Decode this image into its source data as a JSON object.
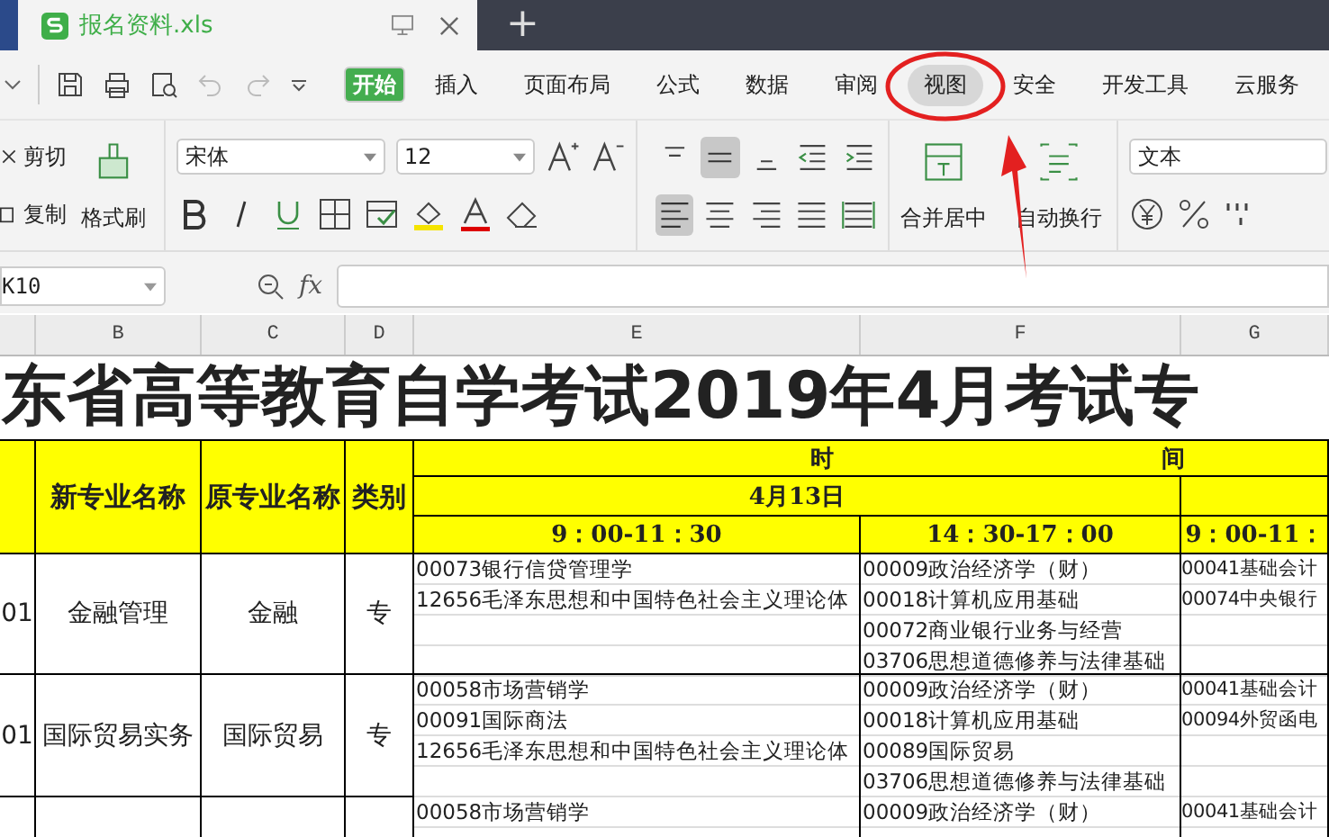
{
  "tab": {
    "title": "报名资料.xls",
    "new_tab": "+"
  },
  "menu": [
    {
      "label": "开始",
      "selected": true,
      "hovered": false
    },
    {
      "label": "插入",
      "selected": false,
      "hovered": false
    },
    {
      "label": "页面布局",
      "selected": false,
      "hovered": false
    },
    {
      "label": "公式",
      "selected": false,
      "hovered": false
    },
    {
      "label": "数据",
      "selected": false,
      "hovered": false
    },
    {
      "label": "审阅",
      "selected": false,
      "hovered": false
    },
    {
      "label": "视图",
      "selected": false,
      "hovered": true
    },
    {
      "label": "安全",
      "selected": false,
      "hovered": false
    },
    {
      "label": "开发工具",
      "selected": false,
      "hovered": false
    },
    {
      "label": "云服务",
      "selected": false,
      "hovered": false
    }
  ],
  "ribbon": {
    "cut": "剪切",
    "copy": "复制",
    "format_painter": "格式刷",
    "font": "宋体",
    "size": "12",
    "merge": "合并居中",
    "wrap": "自动换行",
    "number_format": "文本"
  },
  "formula_bar": {
    "name_box": "K10",
    "fx": "fx"
  },
  "columns": [
    "B",
    "C",
    "D",
    "E",
    "F",
    "G"
  ],
  "sheet": {
    "title": "东省高等教育自学考试2019年4月考试专",
    "headers": [
      "新专业名称",
      "原专业名称",
      "类别"
    ],
    "time_header": [
      "时",
      "间"
    ],
    "date": "4月13日",
    "times": [
      "9：00-11：30",
      "14：30-17：00",
      "9：00-11："
    ],
    "rows": [
      {
        "code": "01",
        "major": "金融管理",
        "old": "金融",
        "type": "专",
        "e": [
          "00073银行信贷管理学",
          "12656毛泽东思想和中国特色社会主义理论体"
        ],
        "f": [
          "00009政治经济学（财）",
          "00018计算机应用基础",
          "00072商业银行业务与经营",
          "03706思想道德修养与法律基础"
        ],
        "g": [
          "00041基础会计",
          "00074中央银行"
        ]
      },
      {
        "code": "01",
        "major": "国际贸易实务",
        "old": "国际贸易",
        "type": "专",
        "e": [
          "00058市场营销学",
          "00091国际商法",
          "12656毛泽东思想和中国特色社会主义理论体"
        ],
        "f": [
          "00009政治经济学（财）",
          "00018计算机应用基础",
          "00089国际贸易",
          "03706思想道德修养与法律基础"
        ],
        "g": [
          "00041基础会计",
          "00094外贸函电"
        ]
      },
      {
        "e": [
          "00058市场营销学"
        ],
        "f": [
          "00009政治经济学（财）"
        ],
        "g": [
          "00041基础会计"
        ]
      }
    ]
  }
}
